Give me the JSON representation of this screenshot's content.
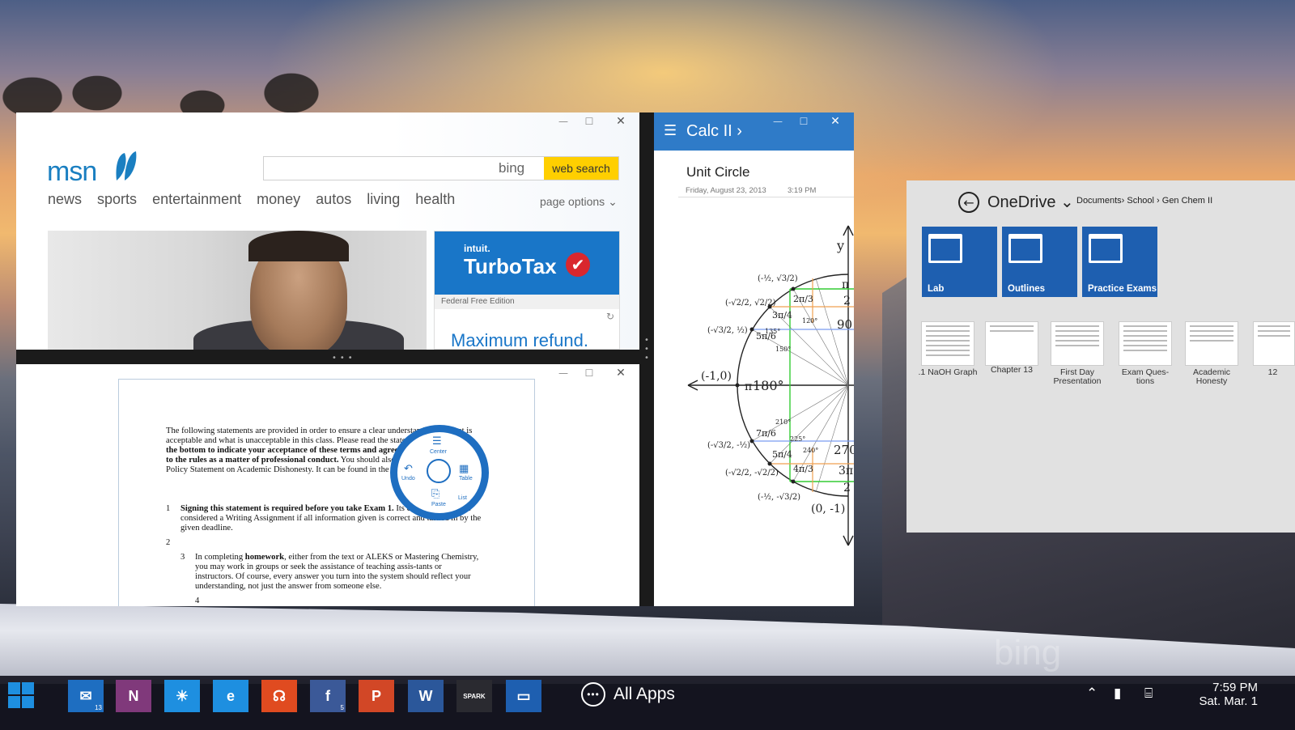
{
  "msn": {
    "logo": "msn",
    "search_placeholder": "",
    "bing_label": "bing",
    "web_search_label": "web search",
    "nav": [
      "news",
      "sports",
      "entertainment",
      "money",
      "autos",
      "living",
      "health"
    ],
    "page_options": "page options ⌄",
    "ad": {
      "intuit": "intuit.",
      "brand": "TurboTax",
      "edition": "Federal Free Edition",
      "headline": "Maximum refund."
    }
  },
  "doc": {
    "para1_a": "The following statements are provided in order to ensure a clear understanding of what is acceptable and what is unacceptable in this class.  Please read the state-ments ",
    "para1_b": "then sign at the bottom to indicate your acceptance of these terms and agreement with adherence to the rules as a matter of professional conduct.",
    "para1_c": " You should also read the university’s Policy Statement on Academic Dishonesty. It can be found in the University Catalog.",
    "item1_num": "1",
    "item1_bold": "Signing this statement is required before you take Exam 1.",
    "item1_rest": "  Its completion will be considered a Writing Assignment if all information given is correct and turned in by the given deadline.",
    "item2_num": "2",
    "item3_num": "3",
    "item3_a": "In completing ",
    "item3_bold": "homework",
    "item3_rest": ", either from the text or ALEKS or Mastering Chemistry, you may work in groups or seek the assistance of teaching assis-tants or instructors.  Of course, every answer you turn into the system should reflect your understanding, not just the answer from someone else.",
    "item4_num": "4",
    "radial": {
      "top": "Center",
      "left": "Undo",
      "right": "Table",
      "bottom": "Paste",
      "br": "List"
    }
  },
  "calc": {
    "header_title": "Calc II ›",
    "page_title": "Unit Circle",
    "date": "Friday, August 23, 2013",
    "time": "3:19 PM",
    "labels": {
      "y": "y",
      "left_point": "(-1,0)",
      "pi": "π",
      "deg180": "180°",
      "bottom_point": "(0, -1)",
      "d120": "120°",
      "d135": "135°",
      "d150": "150°",
      "d210": "210°",
      "d225": "225°",
      "d240": "240°",
      "r90": "90",
      "r270": "270",
      "c1": "(-½, √3/2)",
      "c2": "(-√2/2, √2/2)",
      "c3": "(-√3/2, ½)",
      "c4": "(-√3/2, -½)",
      "c5": "(-√2/2, -√2/2)",
      "c6": "(-½, -√3/2)",
      "f2pi3": "2π/3",
      "f3pi4": "3π/4",
      "f5pi6": "5π/6",
      "f7pi6": "7π/6",
      "f5pi4": "5π/4",
      "f4pi3": "4π/3",
      "rpi": "π",
      "r2": "2",
      "r3pi": "3π",
      "r2b": "2"
    }
  },
  "onedrive": {
    "title": "OneDrive ⌄",
    "breadcrumb": "Documents›  School › Gen Chem II",
    "folders": [
      "Lab",
      "Outlines",
      "Practice Exams"
    ],
    "files": [
      ".1 NaOH Graph",
      "Chapter 13",
      "First Day Presentation",
      "Exam Ques-tions",
      "Academic Honesty",
      "12"
    ]
  },
  "taskbar": {
    "apps": [
      {
        "name": "mail",
        "glyph": "✉",
        "color": "#1e6ec1",
        "badge": "13"
      },
      {
        "name": "onenote",
        "glyph": "N",
        "color": "#80397b",
        "badge": ""
      },
      {
        "name": "weather",
        "glyph": "☀",
        "color": "#1e8fe0",
        "badge": ""
      },
      {
        "name": "internet-explorer",
        "glyph": "e",
        "color": "#1e8fe0",
        "badge": ""
      },
      {
        "name": "music",
        "glyph": "☊",
        "color": "#e04b20",
        "badge": ""
      },
      {
        "name": "facebook",
        "glyph": "f",
        "color": "#3b5998",
        "badge": "5"
      },
      {
        "name": "powerpoint",
        "glyph": "P",
        "color": "#d24726",
        "badge": ""
      },
      {
        "name": "word",
        "glyph": "W",
        "color": "#2b579a",
        "badge": ""
      },
      {
        "name": "spark",
        "glyph": "SPARK",
        "color": "#2a2a30",
        "badge": ""
      },
      {
        "name": "onedrive",
        "glyph": "▭",
        "color": "#1e5fb0",
        "badge": ""
      }
    ],
    "all_apps": "All Apps",
    "time": "7:59 PM",
    "date": "Sat. Mar. 1"
  },
  "wallpaper": {
    "watermark": "bing"
  }
}
